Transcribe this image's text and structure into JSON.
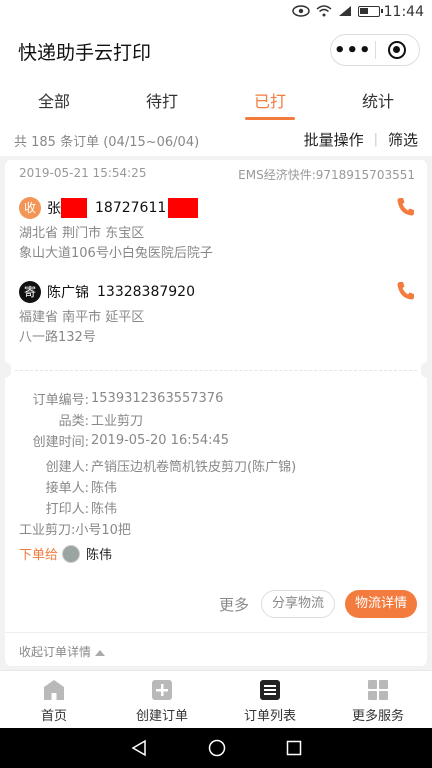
{
  "statusbar": {
    "time": "11:44"
  },
  "app": {
    "title": "快递助手云打印"
  },
  "tabs": [
    {
      "label": "全部"
    },
    {
      "label": "待打"
    },
    {
      "label": "已打"
    },
    {
      "label": "统计"
    }
  ],
  "summary": {
    "count_text": "共 185 条订单 (04/15~06/04)",
    "batch_label": "批量操作",
    "filter_label": "筛选"
  },
  "order": {
    "datetime": "2019-05-21 15:54:25",
    "carrier_no": "EMS经济快件:9718915703551",
    "receiver": {
      "badge": "收",
      "name": "张",
      "phone": "18727611",
      "address_line1": "湖北省 荆门市 东宝区",
      "address_line2": "象山大道106号小白兔医院后院子"
    },
    "sender": {
      "badge": "寄",
      "name": "陈广锦",
      "phone": "13328387920",
      "address_line1": "福建省 南平市 延平区",
      "address_line2": "八一路132号"
    },
    "details": {
      "order_no_label": "订单编号:",
      "order_no": "1539312363557376",
      "category_label": "品类:",
      "category": "工业剪刀",
      "created_label": "创建时间:",
      "created": "2019-05-20 16:54:45",
      "creator_label": "创建人:",
      "creator": "产销压边机卷筒机铁皮剪刀(陈广锦)",
      "receiver_label": "接单人:",
      "receiver": "陈伟",
      "printer_label": "打印人:",
      "printer": "陈伟",
      "item_line": "工业剪刀:小号10把"
    },
    "assign": {
      "label": "下单给",
      "who": "陈伟"
    },
    "actions": {
      "more": "更多",
      "share": "分享物流",
      "track": "物流详情"
    },
    "collapse_label": "收起订单详情"
  },
  "bottomnav": [
    {
      "label": "首页"
    },
    {
      "label": "创建订单"
    },
    {
      "label": "订单列表"
    },
    {
      "label": "更多服务"
    }
  ],
  "colors": {
    "accent": "#f37b3e",
    "redaction": "#ff0000"
  }
}
